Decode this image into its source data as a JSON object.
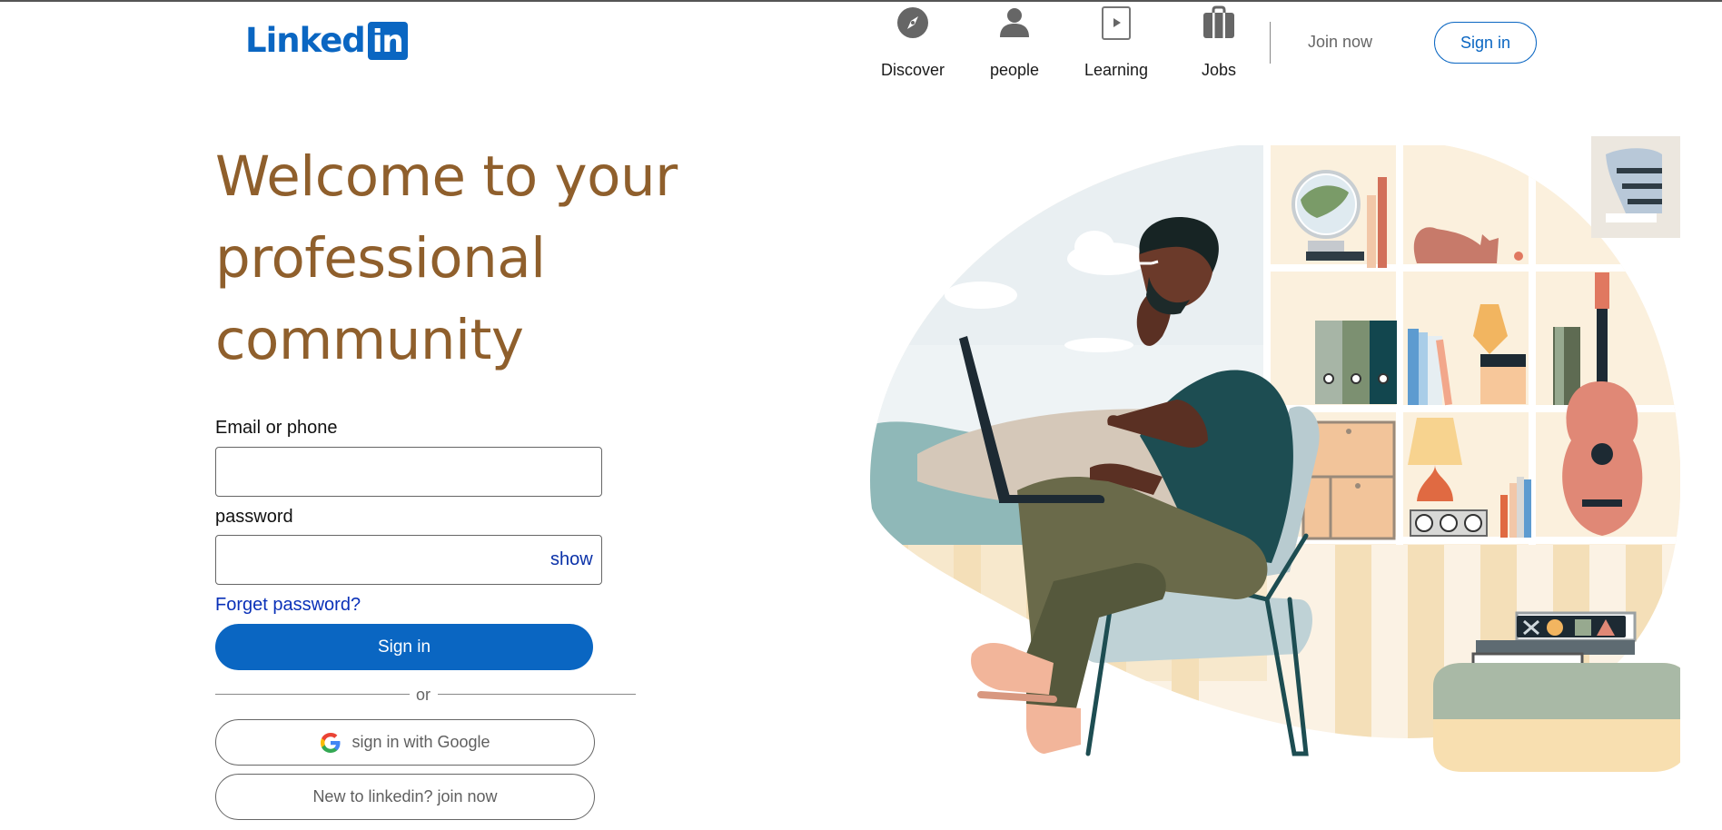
{
  "brand": {
    "logo_text": "Linked",
    "logo_badge": "in"
  },
  "nav": {
    "items": [
      {
        "label": "Discover",
        "icon": "compass-icon"
      },
      {
        "label": "people",
        "icon": "person-icon"
      },
      {
        "label": "Learning",
        "icon": "video-icon"
      },
      {
        "label": "Jobs",
        "icon": "briefcase-icon"
      }
    ],
    "join_label": "Join now",
    "signin_label": "Sign in"
  },
  "hero": {
    "headline": "Welcome to your professional community"
  },
  "form": {
    "email_label": "Email or phone",
    "email_value": "",
    "password_label": "password",
    "password_value": "",
    "show_label": "show",
    "forgot_label": "Forget password?",
    "signin_label": "Sign in",
    "or_label": "or",
    "google_label": "sign in with Google",
    "join_label": "New to linkedin? join now"
  },
  "colors": {
    "brand_blue": "#0a66c2",
    "headline_brown": "#8f5f2c",
    "link_blue": "#0a31b8"
  }
}
